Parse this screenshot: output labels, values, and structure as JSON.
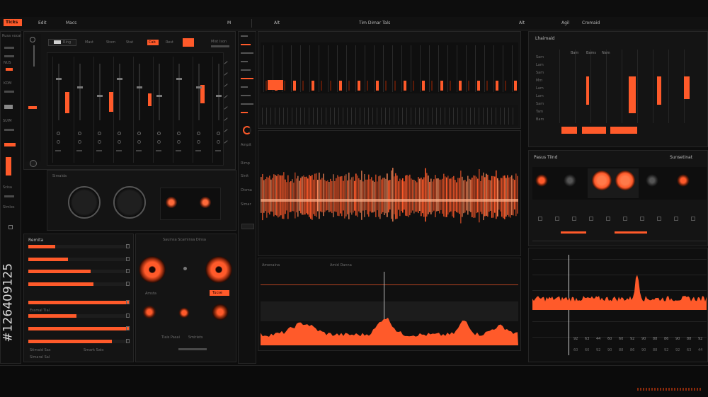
{
  "topbar": {
    "badge": "Ticks",
    "menu": [
      "Edit",
      "Macs",
      "M",
      "Alt",
      "Tim Dimar Tals",
      "Alt",
      "Agil",
      "Cromaid"
    ]
  },
  "left_sidebar": {
    "items": [
      "Rusa vocal",
      "NUS",
      "KDM",
      "SUIM",
      "Scisa",
      "Simles",
      "Smid",
      "Sams"
    ],
    "watermark_id": "#126409125"
  },
  "mixer": {
    "tabs": [
      "Ring",
      "Mast",
      "Stom",
      "Stat",
      "Cab",
      "Rest"
    ],
    "right_label": "Mist Ison",
    "knob_section_label": "Simaida"
  },
  "left_bottom": {
    "title": "Remita",
    "list_label": "Essmal Tial",
    "footer_a": "Stimaid Sas",
    "footer_b": "Simaral Sal",
    "footer_c": "Smark Sats"
  },
  "center_bottom_left": {
    "title": "Sauinsa Scaminsa Dinsa",
    "label_a": "Amsta",
    "label_b": "Tucse",
    "label_c": "Tiais Pasai",
    "label_d": "Smiriets"
  },
  "side_strip": {
    "labels": [
      "Ampit",
      "Rimp",
      "Sinit",
      "Disma",
      "Simar",
      "Astit"
    ]
  },
  "main_wave": {
    "header_left": "Amenaina",
    "header_mid": "Amid Danna"
  },
  "right_top": {
    "title": "Lhaimaid",
    "ticks": [
      "Sam",
      "Lam",
      "Sam",
      "Mm",
      "Lam",
      "Lam",
      "Sam",
      "Tam",
      "Bam"
    ],
    "labels": [
      "Bam",
      "Bams",
      "Nam"
    ]
  },
  "right_mid": {
    "title": "Pasus Tiind",
    "right_title": "Sunsetinat"
  },
  "spectrum": {
    "axis": [
      "92",
      "63",
      "44",
      "60",
      "60",
      "92",
      "90",
      "88",
      "86",
      "90",
      "88",
      "92"
    ]
  },
  "colors": {
    "accent": "#ff5a2a",
    "background": "#0d0d0d",
    "panel": "#141414"
  }
}
